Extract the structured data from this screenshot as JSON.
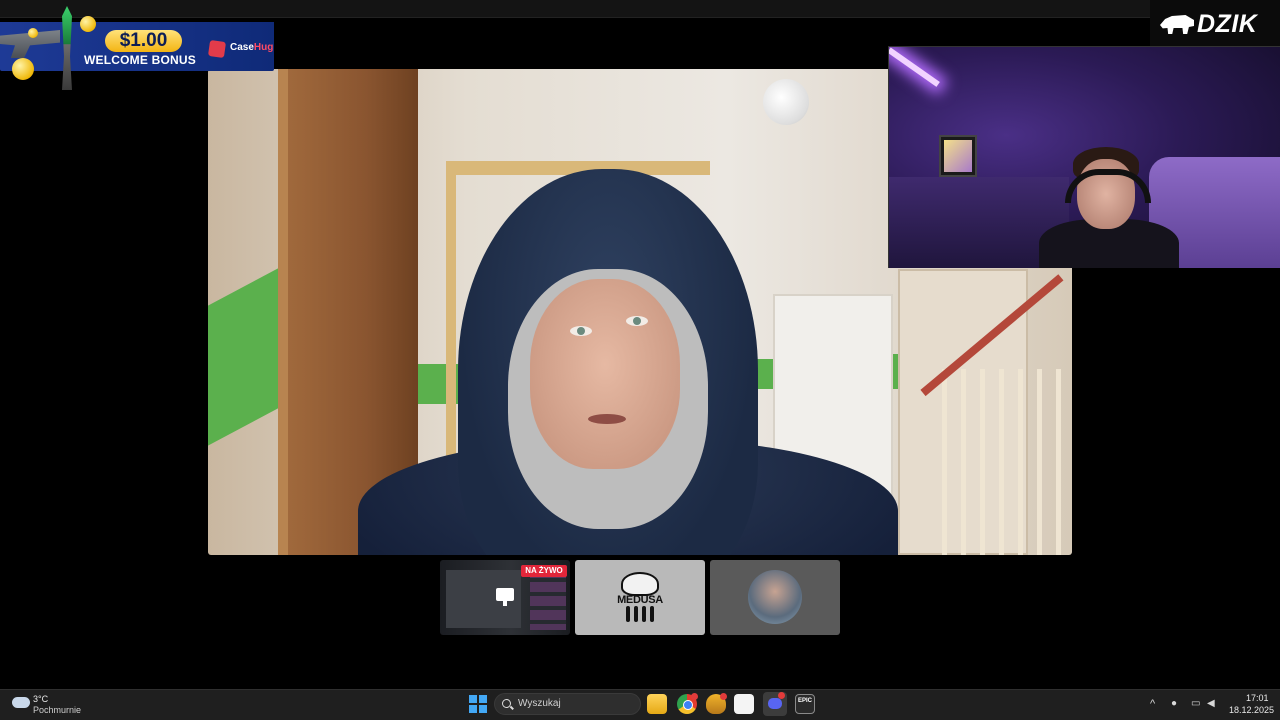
{
  "overlay": {
    "bonus": {
      "amount": "$1.00",
      "text": "WELCOME BONUS",
      "brand_prefix": "Case",
      "brand_suffix": "Hug"
    },
    "channel_logo": "DZIK"
  },
  "call": {
    "main_participant": "webcam",
    "thumbnails": [
      {
        "type": "screen-share",
        "badge": "NA ŻYWO"
      },
      {
        "type": "logo",
        "label": "MEDUSA"
      },
      {
        "type": "avatar"
      }
    ]
  },
  "taskbar": {
    "weather": {
      "temp": "3°C",
      "desc": "Pochmurnie"
    },
    "search_placeholder": "Wyszukaj",
    "apps": [
      "explorer-icon",
      "chrome-icon",
      "app-icon",
      "app-icon",
      "discord-icon",
      "epic-games-icon"
    ],
    "epic_label": "EPIC",
    "clock": {
      "time": "17:01",
      "date": "18.12.2025"
    }
  },
  "colors": {
    "live_badge": "#e2263a",
    "bonus_bg": "#1e3a96",
    "taskbar": "#1f1f1f"
  }
}
